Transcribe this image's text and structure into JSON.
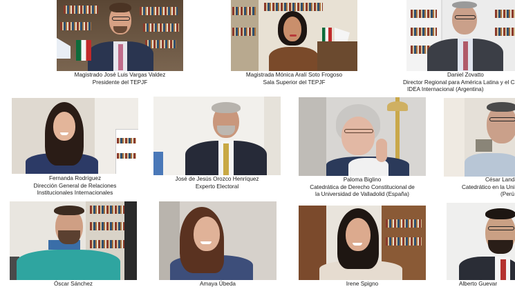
{
  "participants": [
    {
      "name": "Magistrado José Luis Vargas Valdez",
      "role1": "Presidente del TEPJF",
      "role2": ""
    },
    {
      "name": "Magistrada Mónica Aralí Soto Frogoso",
      "role1": "Sala Superior del TEPJF",
      "role2": ""
    },
    {
      "name": "Daniel Zovatto",
      "role1": "Director Regional para América Latina y el Ca",
      "role2": "IDEA Internacional (Argentina)"
    },
    {
      "name": "Fernanda Rodríguez",
      "role1": "Dirección General de Relaciones",
      "role2": "Institucionales Internacionales"
    },
    {
      "name": "José de Jesús Orozco Henríquez",
      "role1": "Experto Electoral",
      "role2": ""
    },
    {
      "name": "Paloma Biglino",
      "role1": "Catedrática de Derecho Constitucional de",
      "role2": "la Universidad de Valladolid (España)"
    },
    {
      "name": "César Landa",
      "role1": "Catedrático en la Uni",
      "role2": "(Perú"
    },
    {
      "name": "Óscar Sánchez",
      "role1": "",
      "role2": ""
    },
    {
      "name": "Amaya Úbeda",
      "role1": "",
      "role2": ""
    },
    {
      "name": "Irene Spigno",
      "role1": "",
      "role2": ""
    },
    {
      "name": "Alberto Guevar",
      "role1": "",
      "role2": ""
    }
  ],
  "colors": {
    "background": "#ffffff",
    "caption_text": "#1a1a1a"
  }
}
